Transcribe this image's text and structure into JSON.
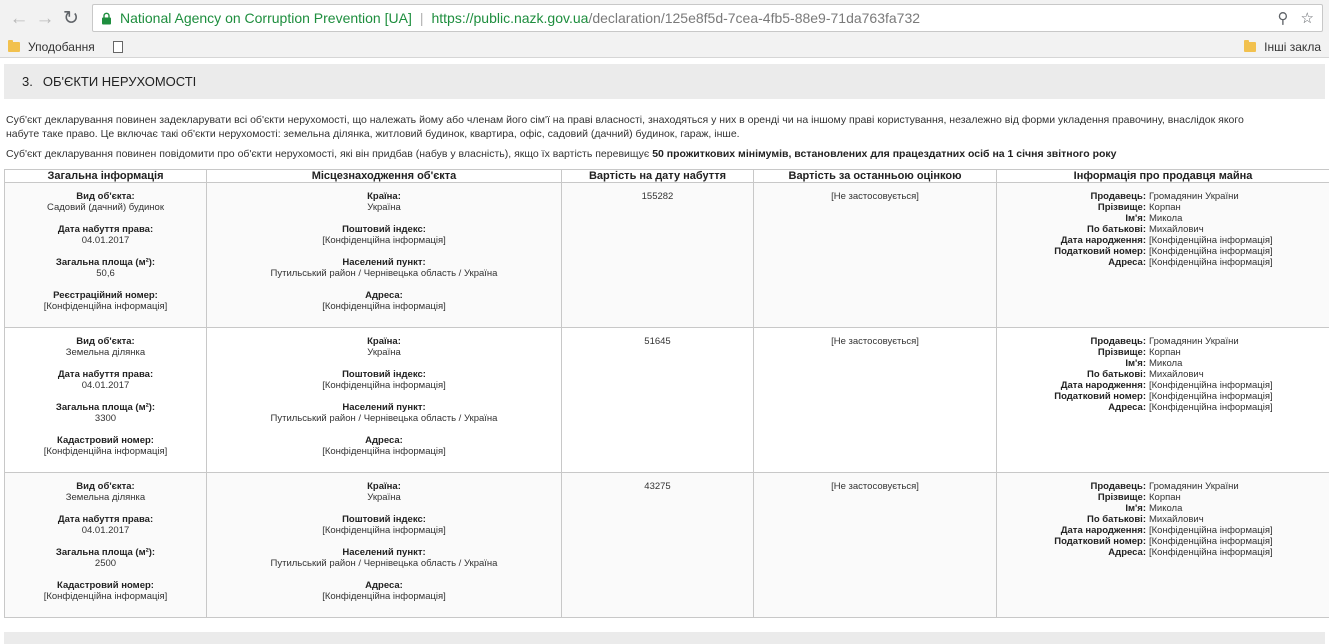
{
  "browser": {
    "site_name": "National Agency on Corruption Prevention [UA]",
    "url_host": "https://public.nazk.gov.ua",
    "url_path": "/declaration/125e8f5d-7cea-4fb5-88e9-71da763fa732",
    "bookmarks": {
      "favorites": "Уподобання",
      "other": "Інші закла"
    }
  },
  "section": {
    "number": "3.",
    "title": "ОБ'ЄКТИ НЕРУХОМОСТІ",
    "paragraph1": "Суб'єкт декларування повинен задекларувати всі об'єкти нерухомості, що належать йому або членам його сім'ї на праві власності, знаходяться у них в оренді чи на іншому праві користування, незалежно від форми укладення правочину, внаслідок якого",
    "paragraph1b": "набуте таке право. Це включає такі об'єкти нерухомості: земельна ділянка, житловий будинок, квартира, офіс, садовий (дачний) будинок, гараж, інше.",
    "paragraph2_start": "Суб'єкт декларування повинен повідомити про об'єкти нерухомості, які він придбав (набув у власність), якщо їх вартість перевищує ",
    "paragraph2_bold": "50 прожиткових мінімумів, встановлених для працездатних осіб на 1 січня звітного року"
  },
  "table": {
    "headers": {
      "general": "Загальна інформація",
      "location": "Місцезнаходження об'єкта",
      "value_acq": "Вартість на дату набуття",
      "value_last": "Вартість за останньою оцінкою",
      "seller": "Інформація про продавця майна"
    },
    "rows": [
      {
        "type_label": "Вид об'єкта:",
        "type": "Садовий (дачний) будинок",
        "date_label": "Дата набуття права:",
        "date": "04.01.2017",
        "area_label": "Загальна площа (м²):",
        "area": "50,6",
        "reg_label": "Реєстраційний номер:",
        "reg": "[Конфіденційна інформація]",
        "country_label": "Країна:",
        "country": "Україна",
        "zip_label": "Поштовий індекс:",
        "zip": "[Конфіденційна інформація]",
        "city_label": "Населений пункт:",
        "city": "Путильський район / Чернівецька область / Україна",
        "addr_label": "Адреса:",
        "addr": "[Конфіденційна інформація]",
        "value_acq": "155282",
        "value_last": "[Не застосовується]",
        "seller": {
          "seller_label": "Продавець:",
          "seller": "Громадянин України",
          "surname_label": "Прізвище:",
          "surname": "Корпан",
          "name_label": "Ім'я:",
          "name": "Микола",
          "patronymic_label": "По батькові:",
          "patronymic": "Михайлович",
          "birth_label": "Дата народження:",
          "birth": "[Конфіденційна інформація]",
          "tax_label": "Податковий номер:",
          "tax": "[Конфіденційна інформація]",
          "address_label": "Адреса:",
          "address": "[Конфіденційна інформація]"
        }
      },
      {
        "type_label": "Вид об'єкта:",
        "type": "Земельна ділянка",
        "date_label": "Дата набуття права:",
        "date": "04.01.2017",
        "area_label": "Загальна площа (м²):",
        "area": "3300",
        "reg_label": "Кадастровий номер:",
        "reg": "[Конфіденційна інформація]",
        "country_label": "Країна:",
        "country": "Україна",
        "zip_label": "Поштовий індекс:",
        "zip": "[Конфіденційна інформація]",
        "city_label": "Населений пункт:",
        "city": "Путильський район / Чернівецька область / Україна",
        "addr_label": "Адреса:",
        "addr": "[Конфіденційна інформація]",
        "value_acq": "51645",
        "value_last": "[Не застосовується]",
        "seller": {
          "seller_label": "Продавець:",
          "seller": "Громадянин України",
          "surname_label": "Прізвище:",
          "surname": "Корпан",
          "name_label": "Ім'я:",
          "name": "Микола",
          "patronymic_label": "По батькові:",
          "patronymic": "Михайлович",
          "birth_label": "Дата народження:",
          "birth": "[Конфіденційна інформація]",
          "tax_label": "Податковий номер:",
          "tax": "[Конфіденційна інформація]",
          "address_label": "Адреса:",
          "address": "[Конфіденційна інформація]"
        }
      },
      {
        "type_label": "Вид об'єкта:",
        "type": "Земельна ділянка",
        "date_label": "Дата набуття права:",
        "date": "04.01.2017",
        "area_label": "Загальна площа (м²):",
        "area": "2500",
        "reg_label": "Кадастровий номер:",
        "reg": "[Конфіденційна інформація]",
        "country_label": "Країна:",
        "country": "Україна",
        "zip_label": "Поштовий індекс:",
        "zip": "[Конфіденційна інформація]",
        "city_label": "Населений пункт:",
        "city": "Путильський район / Чернівецька область / Україна",
        "addr_label": "Адреса:",
        "addr": "[Конфіденційна інформація]",
        "value_acq": "43275",
        "value_last": "[Не застосовується]",
        "seller": {
          "seller_label": "Продавець:",
          "seller": "Громадянин України",
          "surname_label": "Прізвище:",
          "surname": "Корпан",
          "name_label": "Ім'я:",
          "name": "Микола",
          "patronymic_label": "По батькові:",
          "patronymic": "Михайлович",
          "birth_label": "Дата народження:",
          "birth": "[Конфіденційна інформація]",
          "tax_label": "Податковий номер:",
          "tax": "[Конфіденційна інформація]",
          "address_label": "Адреса:",
          "address": "[Конфіденційна інформація]"
        }
      }
    ]
  }
}
